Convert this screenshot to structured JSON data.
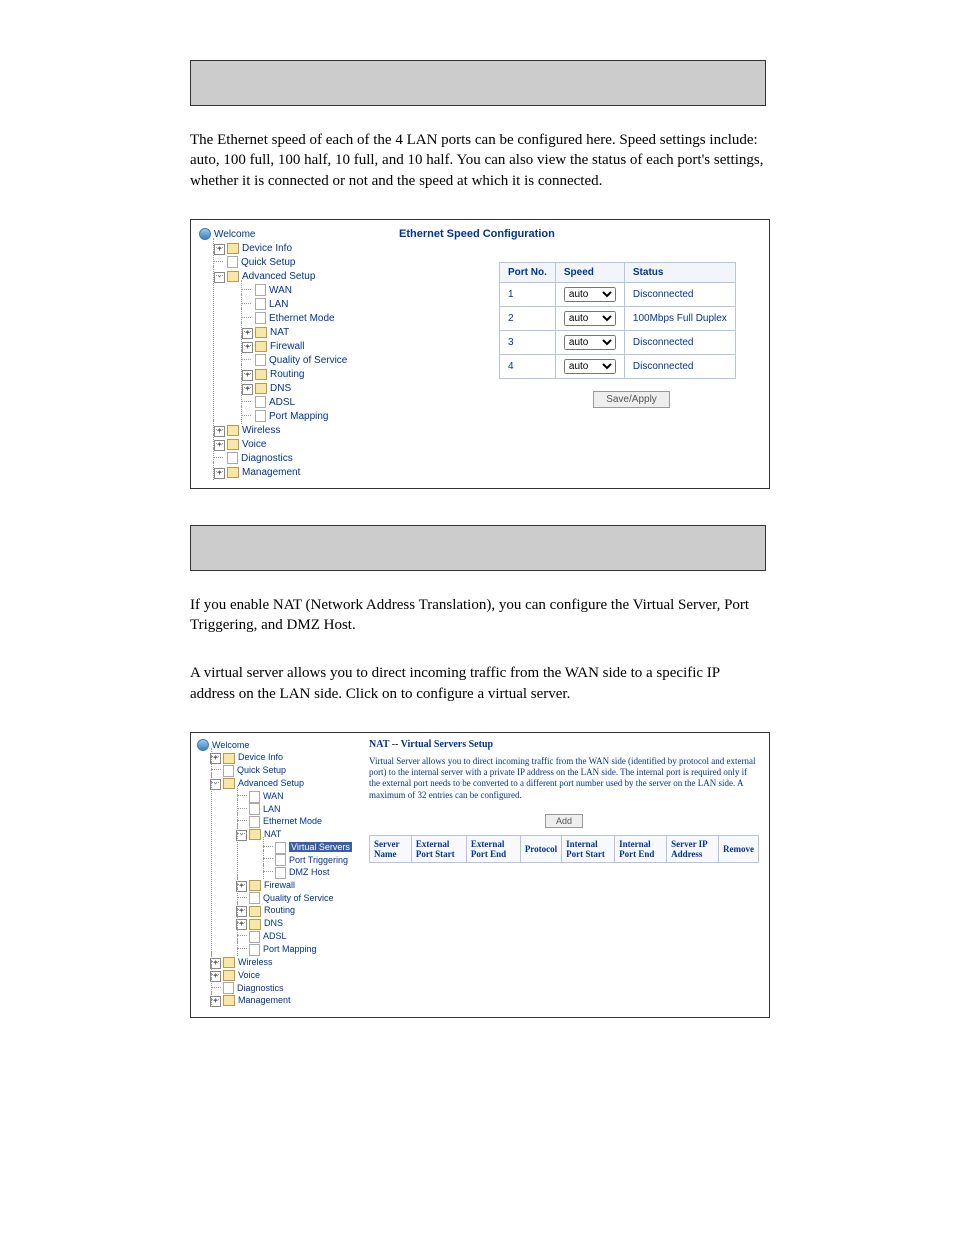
{
  "intro1": {
    "text": "The Ethernet speed of each of the 4 LAN ports can be configured here. Speed settings include: auto, 100 full, 100 half, 10 full, and 10 half. You can also view the status of each port's settings, whether it is connected or not and the speed at which it is connected."
  },
  "screenshot1": {
    "title": "Ethernet Speed Configuration",
    "tree": {
      "root": "Welcome",
      "items": [
        "Device Info",
        "Quick Setup"
      ],
      "adv": "Advanced Setup",
      "adv_items": [
        "WAN",
        "LAN",
        "Ethernet Mode",
        "NAT",
        "Firewall",
        "Quality of Service",
        "Routing",
        "DNS",
        "ADSL",
        "Port Mapping"
      ],
      "rest": [
        "Wireless",
        "Voice",
        "Diagnostics",
        "Management"
      ]
    },
    "table": {
      "headers": [
        "Port No.",
        "Speed",
        "Status"
      ],
      "rows": [
        {
          "port": "1",
          "speed": "auto",
          "status": "Disconnected"
        },
        {
          "port": "2",
          "speed": "auto",
          "status": "100Mbps Full Duplex"
        },
        {
          "port": "3",
          "speed": "auto",
          "status": "Disconnected"
        },
        {
          "port": "4",
          "speed": "auto",
          "status": "Disconnected"
        }
      ],
      "button": "Save/Apply"
    }
  },
  "intro2": {
    "text": "If you enable NAT (Network Address Translation), you can configure the Virtual Server, Port Triggering, and DMZ Host."
  },
  "sub": {
    "text_a": "A virtual server allows you to direct incoming traffic from the WAN side to a specific IP address on the LAN side. Click on ",
    "text_b": " to configure a virtual server."
  },
  "screenshot2": {
    "title": "NAT -- Virtual Servers Setup",
    "desc": "Virtual Server allows you to direct incoming traffic from the WAN side (identified by protocol and external port) to the internal server with a private IP address on the LAN side. The internal port is required only if the external port needs to be converted to a different port number used by the server on the LAN side. A maximum of 32 entries can be configured.",
    "add": "Add",
    "headers": [
      "Server Name",
      "External Port Start",
      "External Port End",
      "Protocol",
      "Internal Port Start",
      "Internal Port End",
      "Server IP Address",
      "Remove"
    ],
    "tree": {
      "root": "Welcome",
      "items": [
        "Device Info",
        "Quick Setup"
      ],
      "adv": "Advanced Setup",
      "adv_items": [
        "WAN",
        "LAN",
        "Ethernet Mode"
      ],
      "nat": "NAT",
      "nat_items": [
        "Virtual Servers",
        "Port Triggering",
        "DMZ Host"
      ],
      "adv_rest": [
        "Firewall",
        "Quality of Service",
        "Routing",
        "DNS",
        "ADSL",
        "Port Mapping"
      ],
      "rest": [
        "Wireless",
        "Voice",
        "Diagnostics",
        "Management"
      ]
    }
  }
}
